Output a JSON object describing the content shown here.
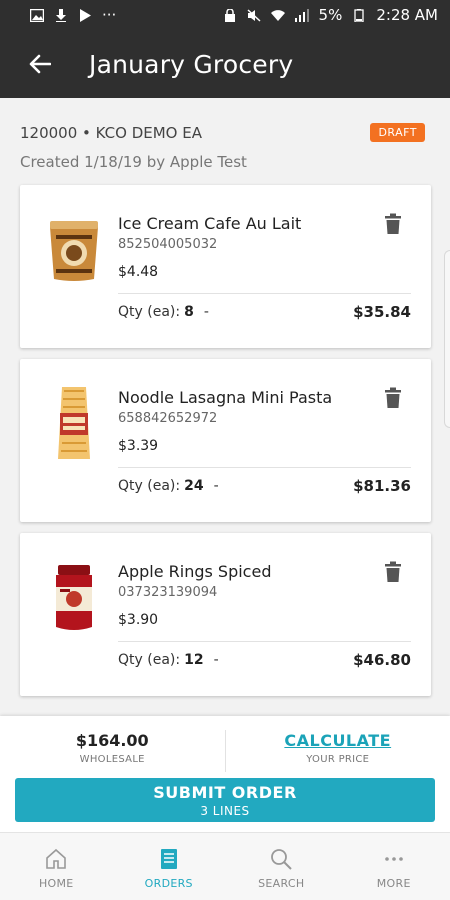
{
  "status_bar": {
    "battery": "5%",
    "time": "2:28 AM",
    "dots": "···"
  },
  "app_bar": {
    "title": "January Grocery"
  },
  "order": {
    "account": "120000 • KCO DEMO EA",
    "created": "Created 1/18/19 by Apple Test",
    "status": "DRAFT"
  },
  "items": [
    {
      "name": "Ice Cream Cafe Au Lait",
      "code": "852504005032",
      "price": "$4.48",
      "qty_label": "Qty (ea):",
      "qty": "8",
      "dash": "-",
      "total": "$35.84"
    },
    {
      "name": "Noodle Lasagna Mini Pasta",
      "code": "658842652972",
      "price": "$3.39",
      "qty_label": "Qty (ea):",
      "qty": "24",
      "dash": "-",
      "total": "$81.36"
    },
    {
      "name": "Apple Rings Spiced",
      "code": "037323139094",
      "price": "$3.90",
      "qty_label": "Qty (ea):",
      "qty": "12",
      "dash": "-",
      "total": "$46.80"
    }
  ],
  "footer": {
    "wholesale_value": "$164.00",
    "wholesale_label": "WHOLESALE",
    "calculate_label": "CALCULATE",
    "your_price_label": "YOUR PRICE",
    "submit_label": "SUBMIT ORDER",
    "submit_sub": "3 LINES"
  },
  "nav": [
    {
      "label": "HOME",
      "icon": "home-icon"
    },
    {
      "label": "ORDERS",
      "icon": "orders-icon"
    },
    {
      "label": "SEARCH",
      "icon": "search-icon"
    },
    {
      "label": "MORE",
      "icon": "more-icon"
    }
  ],
  "colors": {
    "appbar": "#2f2f2f",
    "accent": "#22a9c0",
    "draft": "#f37121"
  }
}
